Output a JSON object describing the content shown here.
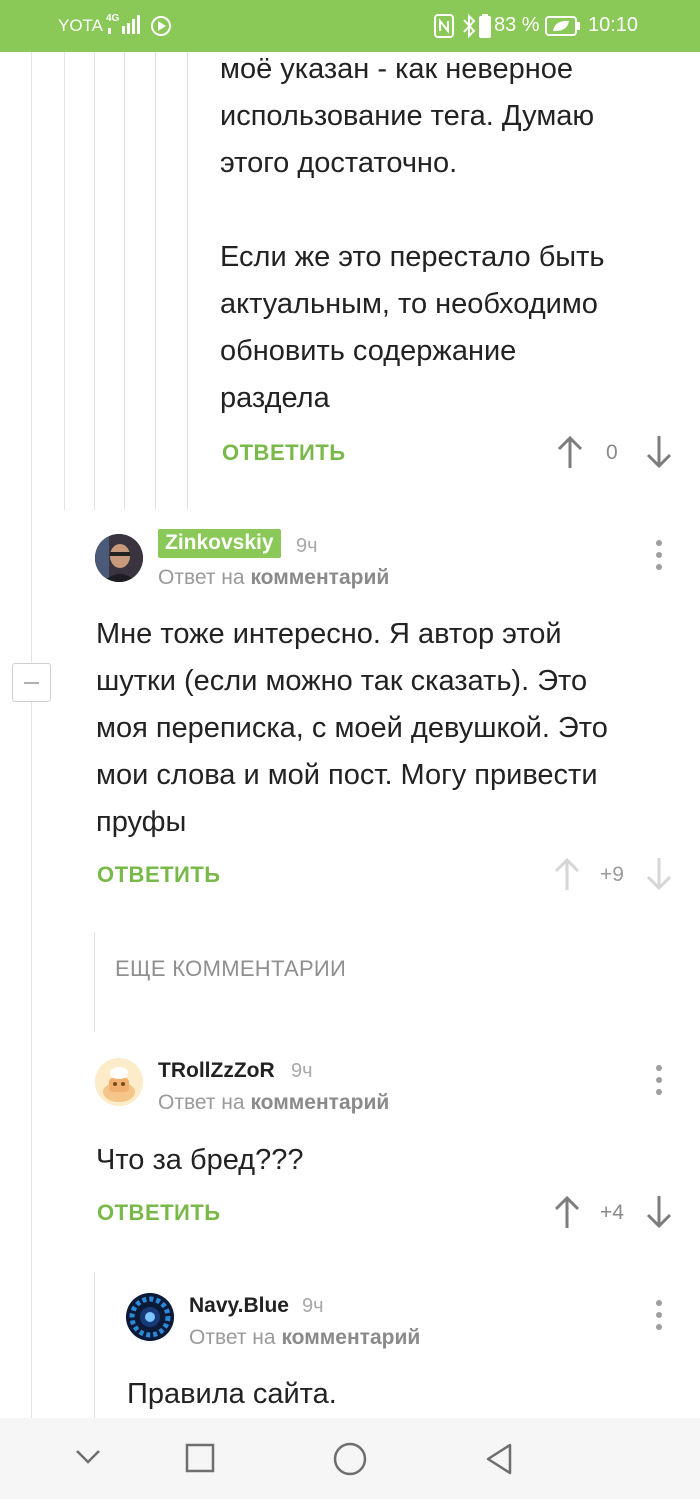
{
  "status_bar": {
    "carrier": "YOTA",
    "network": "4G",
    "nfc": "N",
    "battery_percent": "83 %",
    "time": "10:10"
  },
  "comments": [
    {
      "text_lines": [
        "моё указан - как неверное",
        "использование тега. Думаю",
        "этого достаточно.",
        "",
        "Если же это перестало быть",
        "актуальным, то необходимо",
        "обновить содержание",
        "раздела"
      ],
      "reply_label": "ОТВЕТИТЬ",
      "rating": "0"
    },
    {
      "author": "Zinkovskiy",
      "time": "9ч",
      "reply_prefix": "Ответ на",
      "reply_target": "комментарий",
      "text_lines": [
        "Мне тоже интересно. Я автор этой",
        "шутки (если можно так сказать). Это",
        "моя переписка, с моей девушкой. Это",
        "мои слова и мой пост. Могу привести",
        "пруфы"
      ],
      "reply_label": "ОТВЕТИТЬ",
      "rating": "+9"
    },
    {
      "author": "TRollZzZoR",
      "time": "9ч",
      "reply_prefix": "Ответ на",
      "reply_target": "комментарий",
      "text_lines": [
        "Что за бред???"
      ],
      "reply_label": "ОТВЕТИТЬ",
      "rating": "+4"
    },
    {
      "author": "Navy.Blue",
      "time": "9ч",
      "reply_prefix": "Ответ на",
      "reply_target": "комментарий",
      "text_lines": [
        "Правила сайта."
      ]
    }
  ],
  "more_comments_label": "ЕЩЕ КОММЕНТАРИИ",
  "colors": {
    "accent": "#8ac858",
    "reply": "#79b94a"
  },
  "icons": {
    "collapse": "minus-box-icon",
    "upvote": "arrow-up-icon",
    "downvote": "arrow-down-icon",
    "menu": "kebab-icon",
    "nav_back": "triangle-back-icon",
    "nav_home": "circle-home-icon",
    "nav_recent": "square-recent-icon",
    "nav_down": "chevron-down-icon"
  }
}
